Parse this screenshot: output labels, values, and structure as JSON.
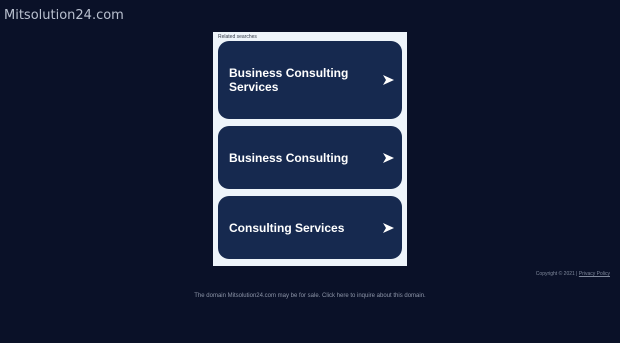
{
  "header": {
    "site_title": "Mitsolution24.com"
  },
  "panel": {
    "heading": "Related searches",
    "results": [
      {
        "label": "Business Consulting Services"
      },
      {
        "label": "Business Consulting"
      },
      {
        "label": "Consulting Services"
      }
    ],
    "arrow_icon": "arrow-right-icon"
  },
  "footer": {
    "copyright": "Copyright © 2021 |",
    "privacy_link": "Privacy Policy",
    "note": "The domain Mitsolution24.com may be for sale. Click here to inquire about this domain."
  },
  "colors": {
    "background": "#0a1128",
    "panel": "#eef4fa",
    "button": "#16294f",
    "text_light": "#ffffff"
  }
}
